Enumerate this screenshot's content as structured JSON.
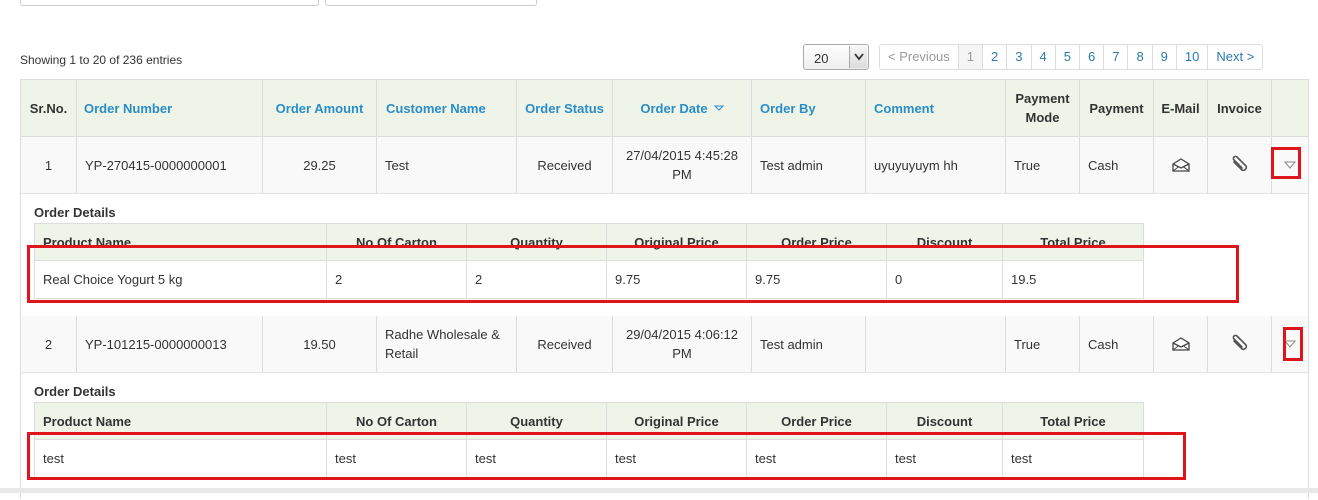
{
  "info_text": "Showing 1 to 20 of 236 entries",
  "page_size": "20",
  "pagination": [
    "< Previous",
    "1",
    "2",
    "3",
    "4",
    "5",
    "6",
    "7",
    "8",
    "9",
    "10",
    "Next >"
  ],
  "columns": [
    "Sr.No.",
    "Order Number",
    "Order Amount",
    "Customer Name",
    "Order Status",
    "Order Date",
    "Order By",
    "Comment",
    "Payment Mode",
    "Payment",
    "E-Mail",
    "Invoice",
    ""
  ],
  "orders": [
    {
      "sr": "1",
      "number": "YP-270415-0000000001",
      "amount": "29.25",
      "customer": "Test",
      "status": "Received",
      "date": "27/04/2015 4:45:28 PM",
      "by": "Test admin",
      "comment": "uyuyuyuym hh",
      "payment_mode": "True",
      "payment": "Cash",
      "details_title": "Order Details",
      "items": [
        {
          "product": "Real Choice Yogurt 5 kg",
          "cartons": "2",
          "quantity": "2",
          "original": "9.75",
          "price": "9.75",
          "discount": "0",
          "total": "19.5"
        }
      ]
    },
    {
      "sr": "2",
      "number": "YP-101215-0000000013",
      "amount": "19.50",
      "customer": "Radhe Wholesale & Retail",
      "status": "Received",
      "date": "29/04/2015 4:06:12 PM",
      "by": "Test admin",
      "comment": "",
      "payment_mode": "True",
      "payment": "Cash",
      "details_title": "Order Details",
      "items": [
        {
          "product": "test",
          "cartons": "test",
          "quantity": "test",
          "original": "test",
          "price": "test",
          "discount": "test",
          "total": "test"
        }
      ]
    }
  ],
  "detail_columns": [
    "Product Name",
    "No Of Carton",
    "Quantity",
    "Original Price",
    "Order Price",
    "Discount",
    "Total Price"
  ],
  "icons": {
    "email": "envelope-open-icon",
    "invoice": "paperclip-icon",
    "expand": "triangle-down-icon",
    "sort": "sort-down-icon"
  },
  "colors": {
    "link": "#2a8dc8",
    "header_bg": "#eef4e8",
    "highlight": "#e0141b"
  }
}
